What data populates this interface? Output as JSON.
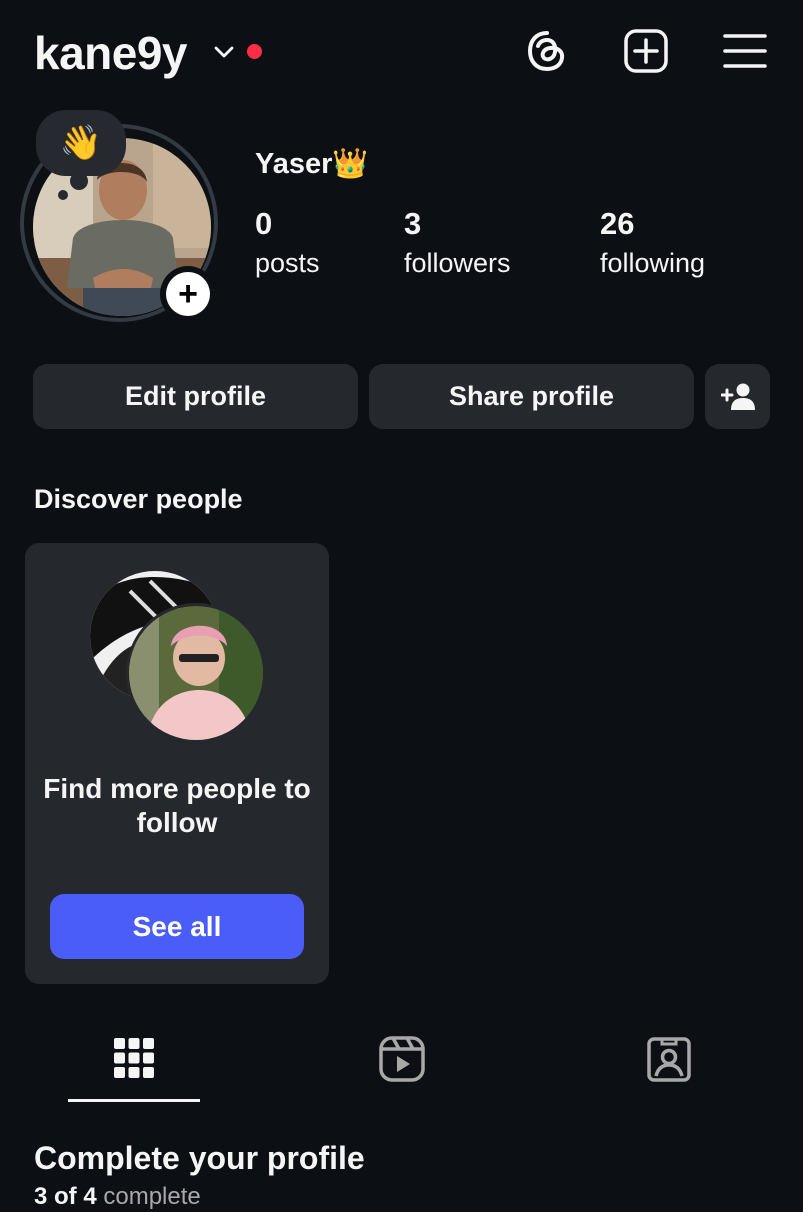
{
  "header": {
    "username": "kane9y",
    "icons": [
      "chevron-down-icon",
      "threads-icon",
      "create-post-icon",
      "menu-icon"
    ]
  },
  "profile": {
    "display_name": "Yaser👑",
    "note_emoji": "👋",
    "add_story_symbol": "+",
    "stats": [
      {
        "value": "0",
        "label": "posts"
      },
      {
        "value": "3",
        "label": "followers"
      },
      {
        "value": "26",
        "label": "following"
      }
    ]
  },
  "actions": {
    "edit_profile": "Edit profile",
    "share_profile": "Share profile",
    "add_user_icon": "add-user-icon"
  },
  "discover": {
    "title": "Discover people",
    "card_text": "Find more people to follow",
    "button": "See all"
  },
  "tabs": [
    {
      "icon": "grid-icon",
      "active": true
    },
    {
      "icon": "reels-icon",
      "active": false
    },
    {
      "icon": "tagged-icon",
      "active": false
    }
  ],
  "complete": {
    "title": "Complete your profile",
    "progress_count": "3 of 4",
    "progress_suffix": " complete"
  },
  "colors": {
    "background": "#0c1014",
    "button": "#25292e",
    "accent": "#4a5df9",
    "notification": "#ff2d45"
  }
}
